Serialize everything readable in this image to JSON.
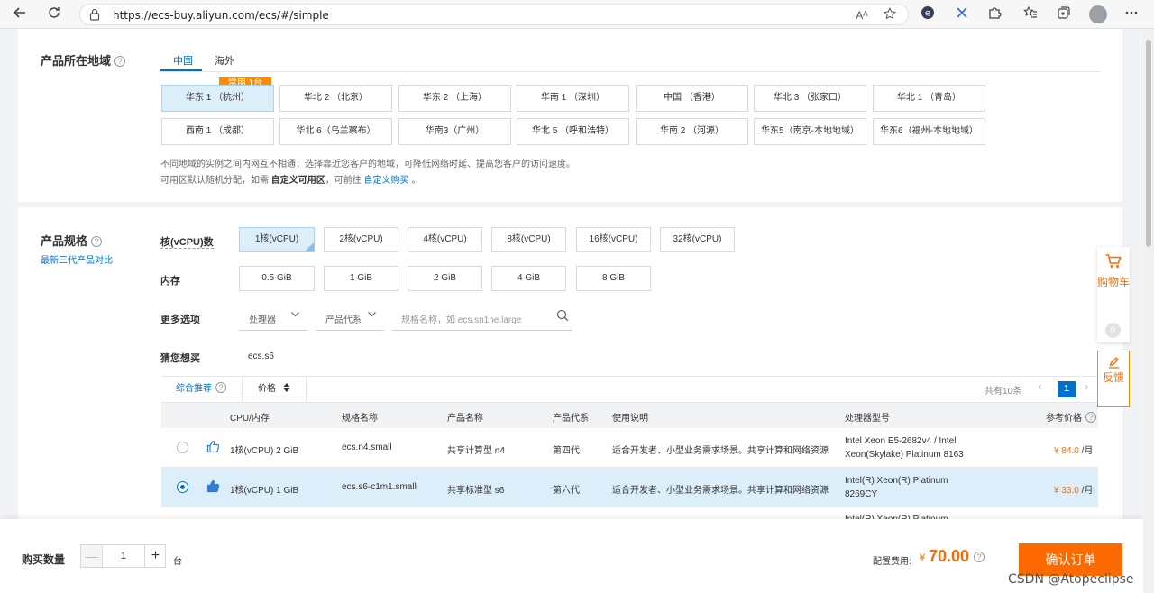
{
  "browser": {
    "url": "https://ecs-buy.aliyun.com/ecs/#/simple",
    "read_aloud_icon": "Aᴬ"
  },
  "region": {
    "title": "产品所在地域",
    "tabs": [
      "中国",
      "海外"
    ],
    "common_badge": "常用 1台",
    "row1": [
      "华东 1 （杭州）",
      "华北 2 （北京）",
      "华东 2 （上海）",
      "华南 1 （深圳）",
      "中国 （香港）",
      "华北 3 （张家口）",
      "华北 1 （青岛）"
    ],
    "row2": [
      "西南 1 （成都）",
      "华北 6（乌兰察布）",
      "华南3（广州）",
      "华北 5 （呼和浩特）",
      "华南 2 （河源）",
      "华东5（南京-本地地域）",
      "华东6（福州-本地地域）"
    ],
    "note1": "不同地域的实例之间内网互不相通；选择靠近您客户的地域，可降低网络时延、提高您客户的访问速度。",
    "note2_prefix": "可用区默认随机分配，如需 ",
    "note2_bold": "自定义可用区",
    "note2_mid": "，可前往 ",
    "note2_link": "自定义购买",
    "note2_suffix": " 。"
  },
  "spec": {
    "title": "产品规格",
    "compare_link": "最新三代产品对比",
    "cores_label": "核(vCPU)数",
    "cores": [
      "1核(vCPU)",
      "2核(vCPU)",
      "4核(vCPU)",
      "8核(vCPU)",
      "16核(vCPU)",
      "32核(vCPU)"
    ],
    "memory_label": "内存",
    "memory": [
      "0.5 GiB",
      "1 GiB",
      "2 GiB",
      "4 GiB",
      "8 GiB"
    ],
    "more_label": "更多选项",
    "processor_dd": "处理器",
    "gen_dd": "产品代系",
    "search_placeholder": "规格名称，如 ecs.sn1ne.large",
    "guess_label": "猜您想买",
    "guess_value": "ecs.s6"
  },
  "table": {
    "sort_recommend": "综合推荐",
    "sort_price": "价格",
    "total": "共有10条",
    "page_prev": "‹",
    "page": "1",
    "page_next": "›",
    "headers": {
      "cpu_mem": "CPU/内存",
      "spec_name": "规格名称",
      "product": "产品名称",
      "generation": "产品代系",
      "usage": "使用说明",
      "processor": "处理器型号",
      "price": "参考价格"
    },
    "rows": [
      {
        "cpu_mem": "1核(vCPU) 2 GiB",
        "spec_name": "ecs.n4.small",
        "product": "共享计算型 n4",
        "generation": "第四代",
        "usage": "适合开发者、小型业务需求场景。共享计算和网络资源",
        "processor_l1": "Intel Xeon E5-2682v4 / Intel",
        "processor_l2": "Xeon(Skylake) Platinum 8163",
        "price": "¥ 84.0",
        "unit": " /月"
      },
      {
        "cpu_mem": "1核(vCPU) 1 GiB",
        "spec_name": "ecs.s6-c1m1.small",
        "product": "共享标准型 s6",
        "generation": "第六代",
        "usage": "适合开发者、小型业务需求场景。共享计算和网络资源",
        "processor_l1": "Intel(R) Xeon(R) Platinum",
        "processor_l2": "8269CY",
        "price": "¥ 33.0",
        "unit": " /月"
      },
      {
        "processor_l1": "Intel(R) Xeon(R) Platinum"
      }
    ]
  },
  "float": {
    "cart_label": "购物车",
    "cart_count": "0",
    "feedback_label": "反馈"
  },
  "bottom": {
    "qty_label": "购买数量",
    "qty_minus": "—",
    "qty_value": "1",
    "qty_plus": "+",
    "qty_unit": "台",
    "fee_label": "配置费用:",
    "fee_currency": "¥",
    "fee_value": "70.00",
    "confirm": "确认订单",
    "watermark": "CSDN @Atopeclipse"
  },
  "colors": {
    "accent": "#0070cc",
    "brand_orange": "#ff6a00",
    "selected_bg": "#dbeefa"
  }
}
